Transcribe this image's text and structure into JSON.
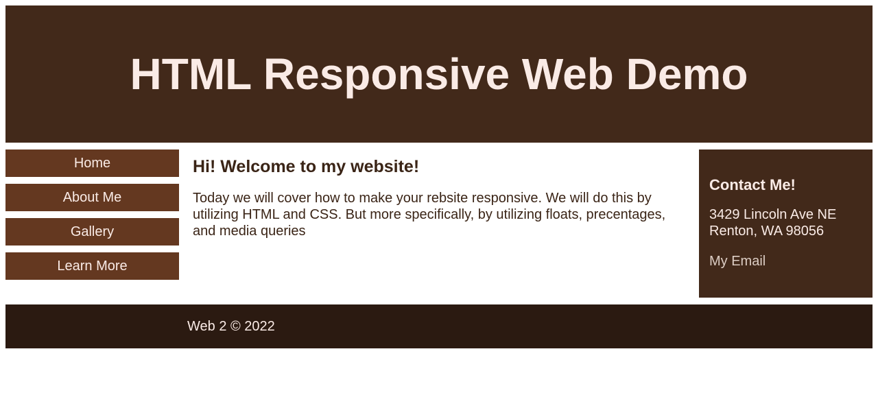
{
  "header": {
    "title": "HTML Responsive Web Demo"
  },
  "nav": {
    "items": [
      {
        "label": "Home"
      },
      {
        "label": "About Me"
      },
      {
        "label": "Gallery"
      },
      {
        "label": "Learn More"
      }
    ]
  },
  "main": {
    "heading": "Hi! Welcome to my website!",
    "body": "Today we will cover how to make your rebsite responsive. We will do this by utilizing HTML and CSS. But more specifically, by utilizing floats, precentages, and media queries"
  },
  "contact": {
    "heading": "Contact Me!",
    "address_line1": "3429 Lincoln Ave NE",
    "address_line2": "Renton, WA 98056",
    "email_label": "My Email"
  },
  "footer": {
    "text": "Web 2 © 2022"
  },
  "colors": {
    "header_bg": "#42291a",
    "nav_bg": "#643820",
    "footer_bg": "#2b1a11",
    "light_text": "#faebe6",
    "dark_text": "#3a2416"
  }
}
